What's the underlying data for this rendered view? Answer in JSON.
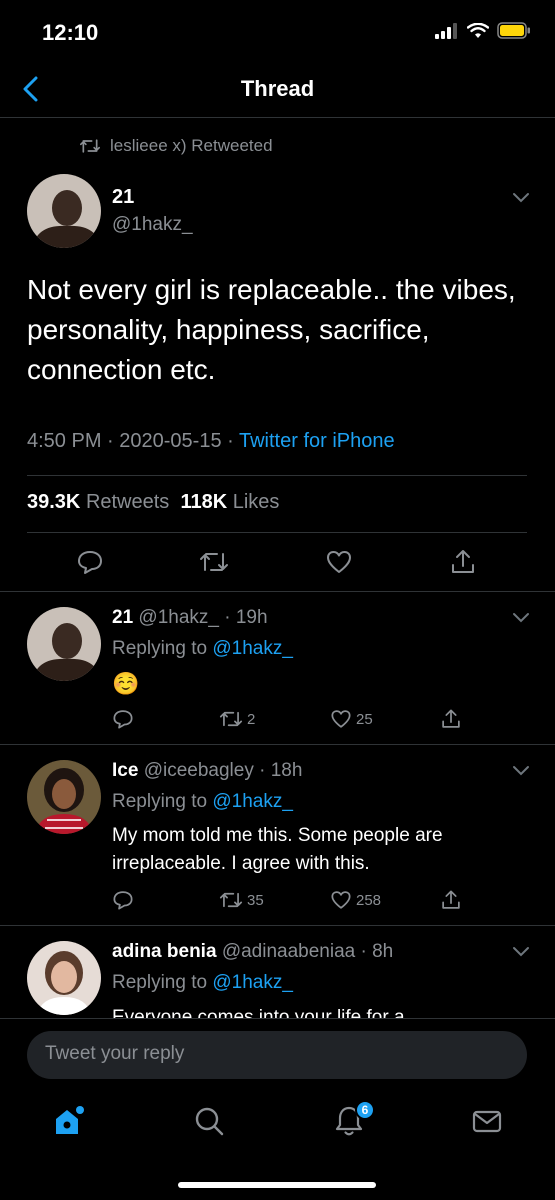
{
  "status": {
    "time": "12:10"
  },
  "nav": {
    "title": "Thread"
  },
  "main": {
    "retweeted_by": "leslieee x) Retweeted",
    "name": "21",
    "handle": "@1hakz_",
    "text": "Not every girl is replaceable.. the vibes, personality, happiness, sacrifice, connection etc.",
    "time": "4:50 PM · 2020-05-15 · ",
    "source": "Twitter for iPhone",
    "retweets_count": "39.3K",
    "retweets_label": "Retweets",
    "likes_count": "118K",
    "likes_label": "Likes"
  },
  "replies": [
    {
      "name": "21",
      "handle_time": "@1hakz_ · 19h",
      "replying_prefix": "Replying to ",
      "replying_handle": "@1hakz_",
      "text": "☺️",
      "retweets": "2",
      "likes": "25"
    },
    {
      "name": "Ice",
      "handle_time": "@iceebagley · 18h",
      "replying_prefix": "Replying to ",
      "replying_handle": "@1hakz_",
      "text": "My mom told me this. Some people are irreplaceable. I agree with this.",
      "retweets": "35",
      "likes": "258"
    },
    {
      "name": "adina benia",
      "handle_time": "@adinaabeniaa · 8h",
      "replying_prefix": "Replying to ",
      "replying_handle": "@1hakz_",
      "text": "Everyone comes into your life for a"
    }
  ],
  "compose": {
    "placeholder": "Tweet your reply"
  },
  "tabbar": {
    "notifications_badge": "6"
  },
  "colors": {
    "accent": "#1da1f2",
    "background": "#000000",
    "muted": "#8b8f94",
    "divider": "#2f3336"
  }
}
